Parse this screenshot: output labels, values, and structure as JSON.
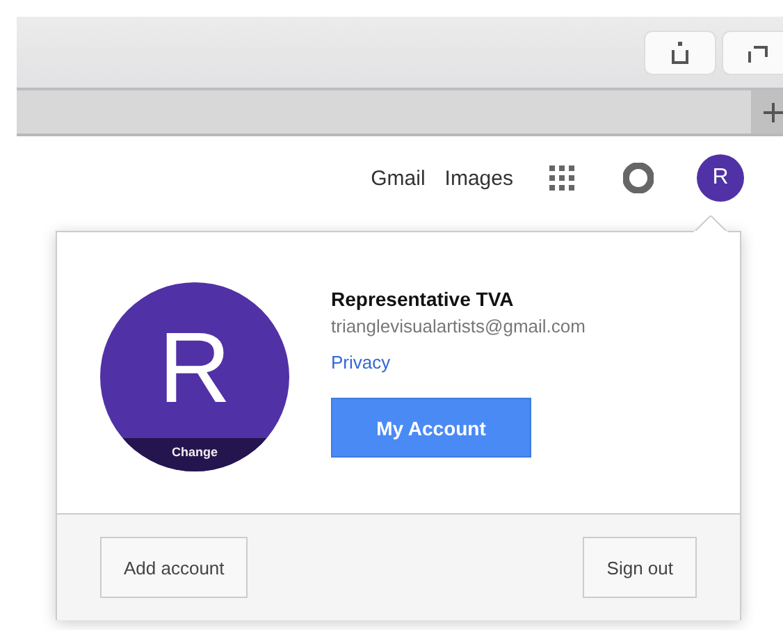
{
  "header_links": [
    {
      "label": "Gmail"
    },
    {
      "label": "Images"
    }
  ],
  "avatar_letter": "R",
  "account_popup": {
    "avatar_letter": "R",
    "change_label": "Change",
    "name": "Representative TVA",
    "email": "trianglevisualartists@gmail.com",
    "privacy_link": "Privacy",
    "my_account_button": "My Account",
    "add_account_button": "Add account",
    "sign_out_button": "Sign out"
  }
}
